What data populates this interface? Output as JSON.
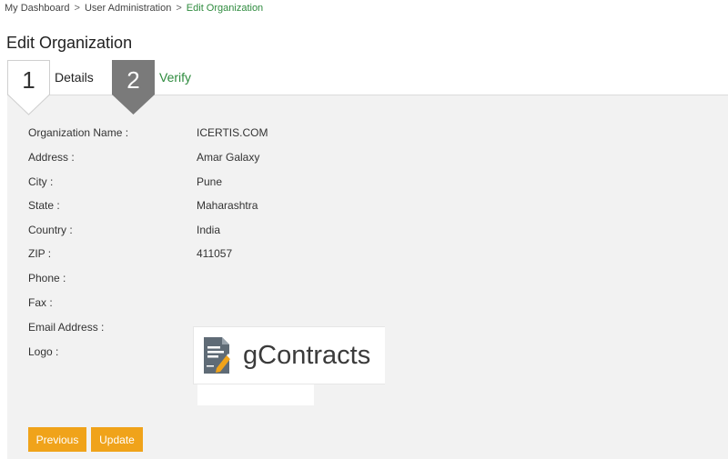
{
  "breadcrumb": {
    "items": [
      "My Dashboard",
      "User Administration"
    ],
    "current": "Edit Organization",
    "separator": ">"
  },
  "page": {
    "title": "Edit Organization"
  },
  "steps": [
    {
      "number": "1",
      "label": "Details",
      "state": "current"
    },
    {
      "number": "2",
      "label": "Verify",
      "state": "active"
    }
  ],
  "fields": [
    {
      "label": "Organization Name :",
      "value": "ICERTIS.COM"
    },
    {
      "label": "Address :",
      "value": "Amar Galaxy"
    },
    {
      "label": "City :",
      "value": "Pune"
    },
    {
      "label": "State :",
      "value": "Maharashtra"
    },
    {
      "label": "Country :",
      "value": "India"
    },
    {
      "label": "ZIP :",
      "value": "411057"
    },
    {
      "label": "Phone :",
      "value": ""
    },
    {
      "label": "Fax :",
      "value": ""
    },
    {
      "label": "Email Address :",
      "value": ""
    },
    {
      "label": "Logo :",
      "value": ""
    }
  ],
  "logo": {
    "text": "gContracts",
    "icon": "contract-document-icon"
  },
  "buttons": {
    "previous": "Previous",
    "update": "Update"
  },
  "colors": {
    "accent": "#f0a31a",
    "link_green": "#2e8b3e",
    "step_gray": "#7a7a7a",
    "panel_bg": "#f2f2f2"
  }
}
